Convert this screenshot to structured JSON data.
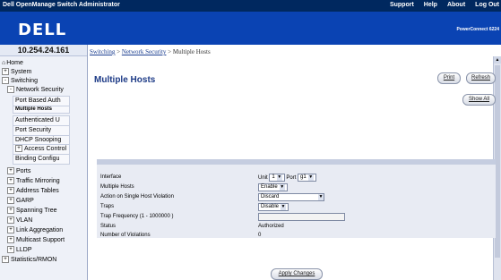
{
  "app": {
    "title": "Dell OpenManage Switch Administrator",
    "top_links": [
      "Support",
      "Help",
      "About",
      "Log Out"
    ],
    "logo": "DELL",
    "product": "PowerConnect 6224"
  },
  "sidebar": {
    "ip": "10.254.24.161",
    "items": [
      {
        "label": "Home",
        "level": 0,
        "expander": "",
        "icon": "home-icon"
      },
      {
        "label": "System",
        "level": 0,
        "expander": "+"
      },
      {
        "label": "Switching",
        "level": 0,
        "expander": "-"
      },
      {
        "label": "Network Security",
        "level": 1,
        "expander": "-"
      },
      {
        "label": "Port Based Auth",
        "level": 2,
        "expander": ""
      },
      {
        "label": "Multiple Hosts",
        "level": 2,
        "expander": "",
        "selected": true
      },
      {
        "label": "Authenticated U",
        "level": 2,
        "expander": ""
      },
      {
        "label": "Port Security",
        "level": 2,
        "expander": ""
      },
      {
        "label": "DHCP Snooping",
        "level": 2,
        "expander": ""
      },
      {
        "label": "Access Control",
        "level": 2,
        "expander": "+"
      },
      {
        "label": "Binding Configu",
        "level": 2,
        "expander": ""
      },
      {
        "label": "Ports",
        "level": 1,
        "expander": "+"
      },
      {
        "label": "Traffic Mirroring",
        "level": 1,
        "expander": "+"
      },
      {
        "label": "Address Tables",
        "level": 1,
        "expander": "+"
      },
      {
        "label": "GARP",
        "level": 1,
        "expander": "+"
      },
      {
        "label": "Spanning Tree",
        "level": 1,
        "expander": "+"
      },
      {
        "label": "VLAN",
        "level": 1,
        "expander": "+"
      },
      {
        "label": "Link Aggregation",
        "level": 1,
        "expander": "+"
      },
      {
        "label": "Multicast Support",
        "level": 1,
        "expander": "+"
      },
      {
        "label": "LLDP",
        "level": 1,
        "expander": "+"
      },
      {
        "label": "Statistics/RMON",
        "level": 0,
        "expander": "+"
      }
    ]
  },
  "breadcrumb": {
    "items": [
      "Switching",
      "Network Security",
      "Multiple Hosts"
    ],
    "separator": ">"
  },
  "page": {
    "title": "Multiple Hosts",
    "buttons": {
      "print": "Print",
      "refresh": "Refresh",
      "show_all": "Show All",
      "apply": "Apply Changes"
    }
  },
  "form": {
    "interface": {
      "label": "Interface",
      "unit_label": "Unit",
      "unit_value": "1",
      "port_label": "Port",
      "port_value": "g1"
    },
    "multiple_hosts": {
      "label": "Multiple Hosts",
      "value": "Enable"
    },
    "violation_action": {
      "label": "Action on Single Host Violation",
      "value": "Discard"
    },
    "traps": {
      "label": "Traps",
      "value": "Disable"
    },
    "trap_frequency": {
      "label": "Trap Frequency (1 - 1000000 )",
      "value": ""
    },
    "status": {
      "label": "Status",
      "value": "Authorized"
    },
    "violations": {
      "label": "Number of Violations",
      "value": "0"
    }
  }
}
